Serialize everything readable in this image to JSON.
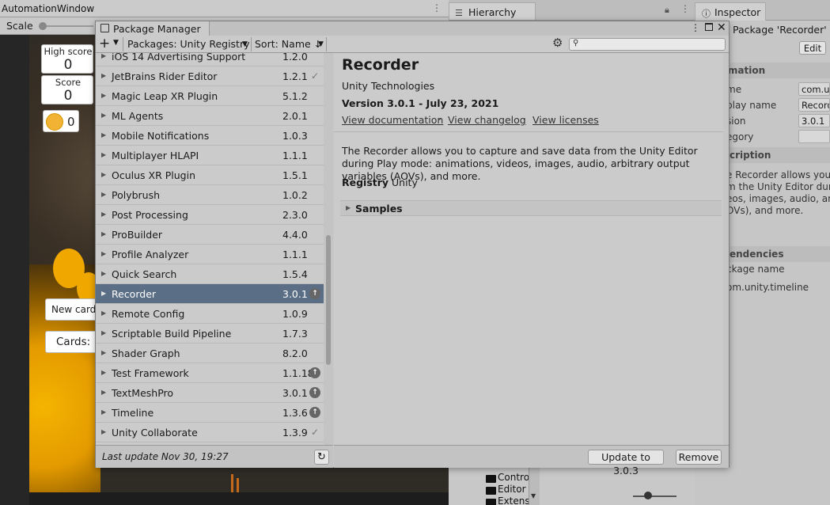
{
  "automation_window": {
    "title": "AutomationWindow",
    "scale_label": "Scale",
    "game": {
      "high_score_label": "High score",
      "high_score_value": "0",
      "score_label": "Score",
      "score_value": "0",
      "coin_value": "0",
      "new_card_label": "New card",
      "cards_label": "Cards:"
    }
  },
  "hierarchy": {
    "tab_label": "Hierarchy",
    "items": [
      "Contro",
      "Editor",
      "Extensi"
    ]
  },
  "inspector": {
    "tab_label": "Inspector",
    "title": "Package 'Recorder'",
    "edit_label": "Edit",
    "information_header": "rmation",
    "fields": [
      {
        "label": "me",
        "value": "com.un"
      },
      {
        "label": "play name",
        "value": "Record"
      },
      {
        "label": "sion",
        "value": "3.0.1"
      },
      {
        "label": "egory",
        "value": ""
      }
    ],
    "description_header": "cription",
    "description_lines": [
      "e Recorder allows you",
      "m the Unity Editor durin",
      "eos, images, audio, arb",
      "OVs), and more."
    ],
    "dependencies_header": "endencies",
    "dep_column": "ckage name",
    "dep_item": "om.unity.timeline"
  },
  "package_manager": {
    "title": "Package Manager",
    "toolbar": {
      "add_symbol": "+",
      "source_label": "Packages: Unity Registry",
      "sort_label": "Sort: Name ↓",
      "search_placeholder": ""
    },
    "packages": [
      {
        "name": "iOS 14 Advertising Support",
        "version": "1.2.0",
        "status": ""
      },
      {
        "name": "JetBrains Rider Editor",
        "version": "1.2.1",
        "status": "check"
      },
      {
        "name": "Magic Leap XR Plugin",
        "version": "5.1.2",
        "status": ""
      },
      {
        "name": "ML Agents",
        "version": "2.0.1",
        "status": ""
      },
      {
        "name": "Mobile Notifications",
        "version": "1.0.3",
        "status": ""
      },
      {
        "name": "Multiplayer HLAPI",
        "version": "1.1.1",
        "status": ""
      },
      {
        "name": "Oculus XR Plugin",
        "version": "1.5.1",
        "status": ""
      },
      {
        "name": "Polybrush",
        "version": "1.0.2",
        "status": ""
      },
      {
        "name": "Post Processing",
        "version": "2.3.0",
        "status": ""
      },
      {
        "name": "ProBuilder",
        "version": "4.4.0",
        "status": ""
      },
      {
        "name": "Profile Analyzer",
        "version": "1.1.1",
        "status": ""
      },
      {
        "name": "Quick Search",
        "version": "1.5.4",
        "status": ""
      },
      {
        "name": "Recorder",
        "version": "3.0.1",
        "status": "update"
      },
      {
        "name": "Remote Config",
        "version": "1.0.9",
        "status": ""
      },
      {
        "name": "Scriptable Build Pipeline",
        "version": "1.7.3",
        "status": ""
      },
      {
        "name": "Shader Graph",
        "version": "8.2.0",
        "status": ""
      },
      {
        "name": "Test Framework",
        "version": "1.1.18",
        "status": "update"
      },
      {
        "name": "TextMeshPro",
        "version": "3.0.1",
        "status": "update"
      },
      {
        "name": "Timeline",
        "version": "1.3.6",
        "status": "update"
      },
      {
        "name": "Unity Collaborate",
        "version": "1.3.9",
        "status": "check"
      }
    ],
    "selected_package": "Recorder",
    "last_update": "Last update Nov 30, 19:27",
    "detail": {
      "title": "Recorder",
      "author": "Unity Technologies",
      "version_line": "Version 3.0.1 - July 23, 2021",
      "link_docs": "View documentation",
      "link_changelog": "View changelog",
      "link_licenses": "View licenses",
      "link_separator": "·",
      "description": "The Recorder allows you to capture and save data from the Unity Editor during Play mode: animations, videos, images, audio, arbitrary output variables (AOVs), and more.",
      "registry_label": "Registry",
      "registry_value": "Unity",
      "samples_label": "Samples"
    },
    "actions": {
      "update_label": "Update to 3.0.3",
      "remove_label": "Remove"
    }
  }
}
